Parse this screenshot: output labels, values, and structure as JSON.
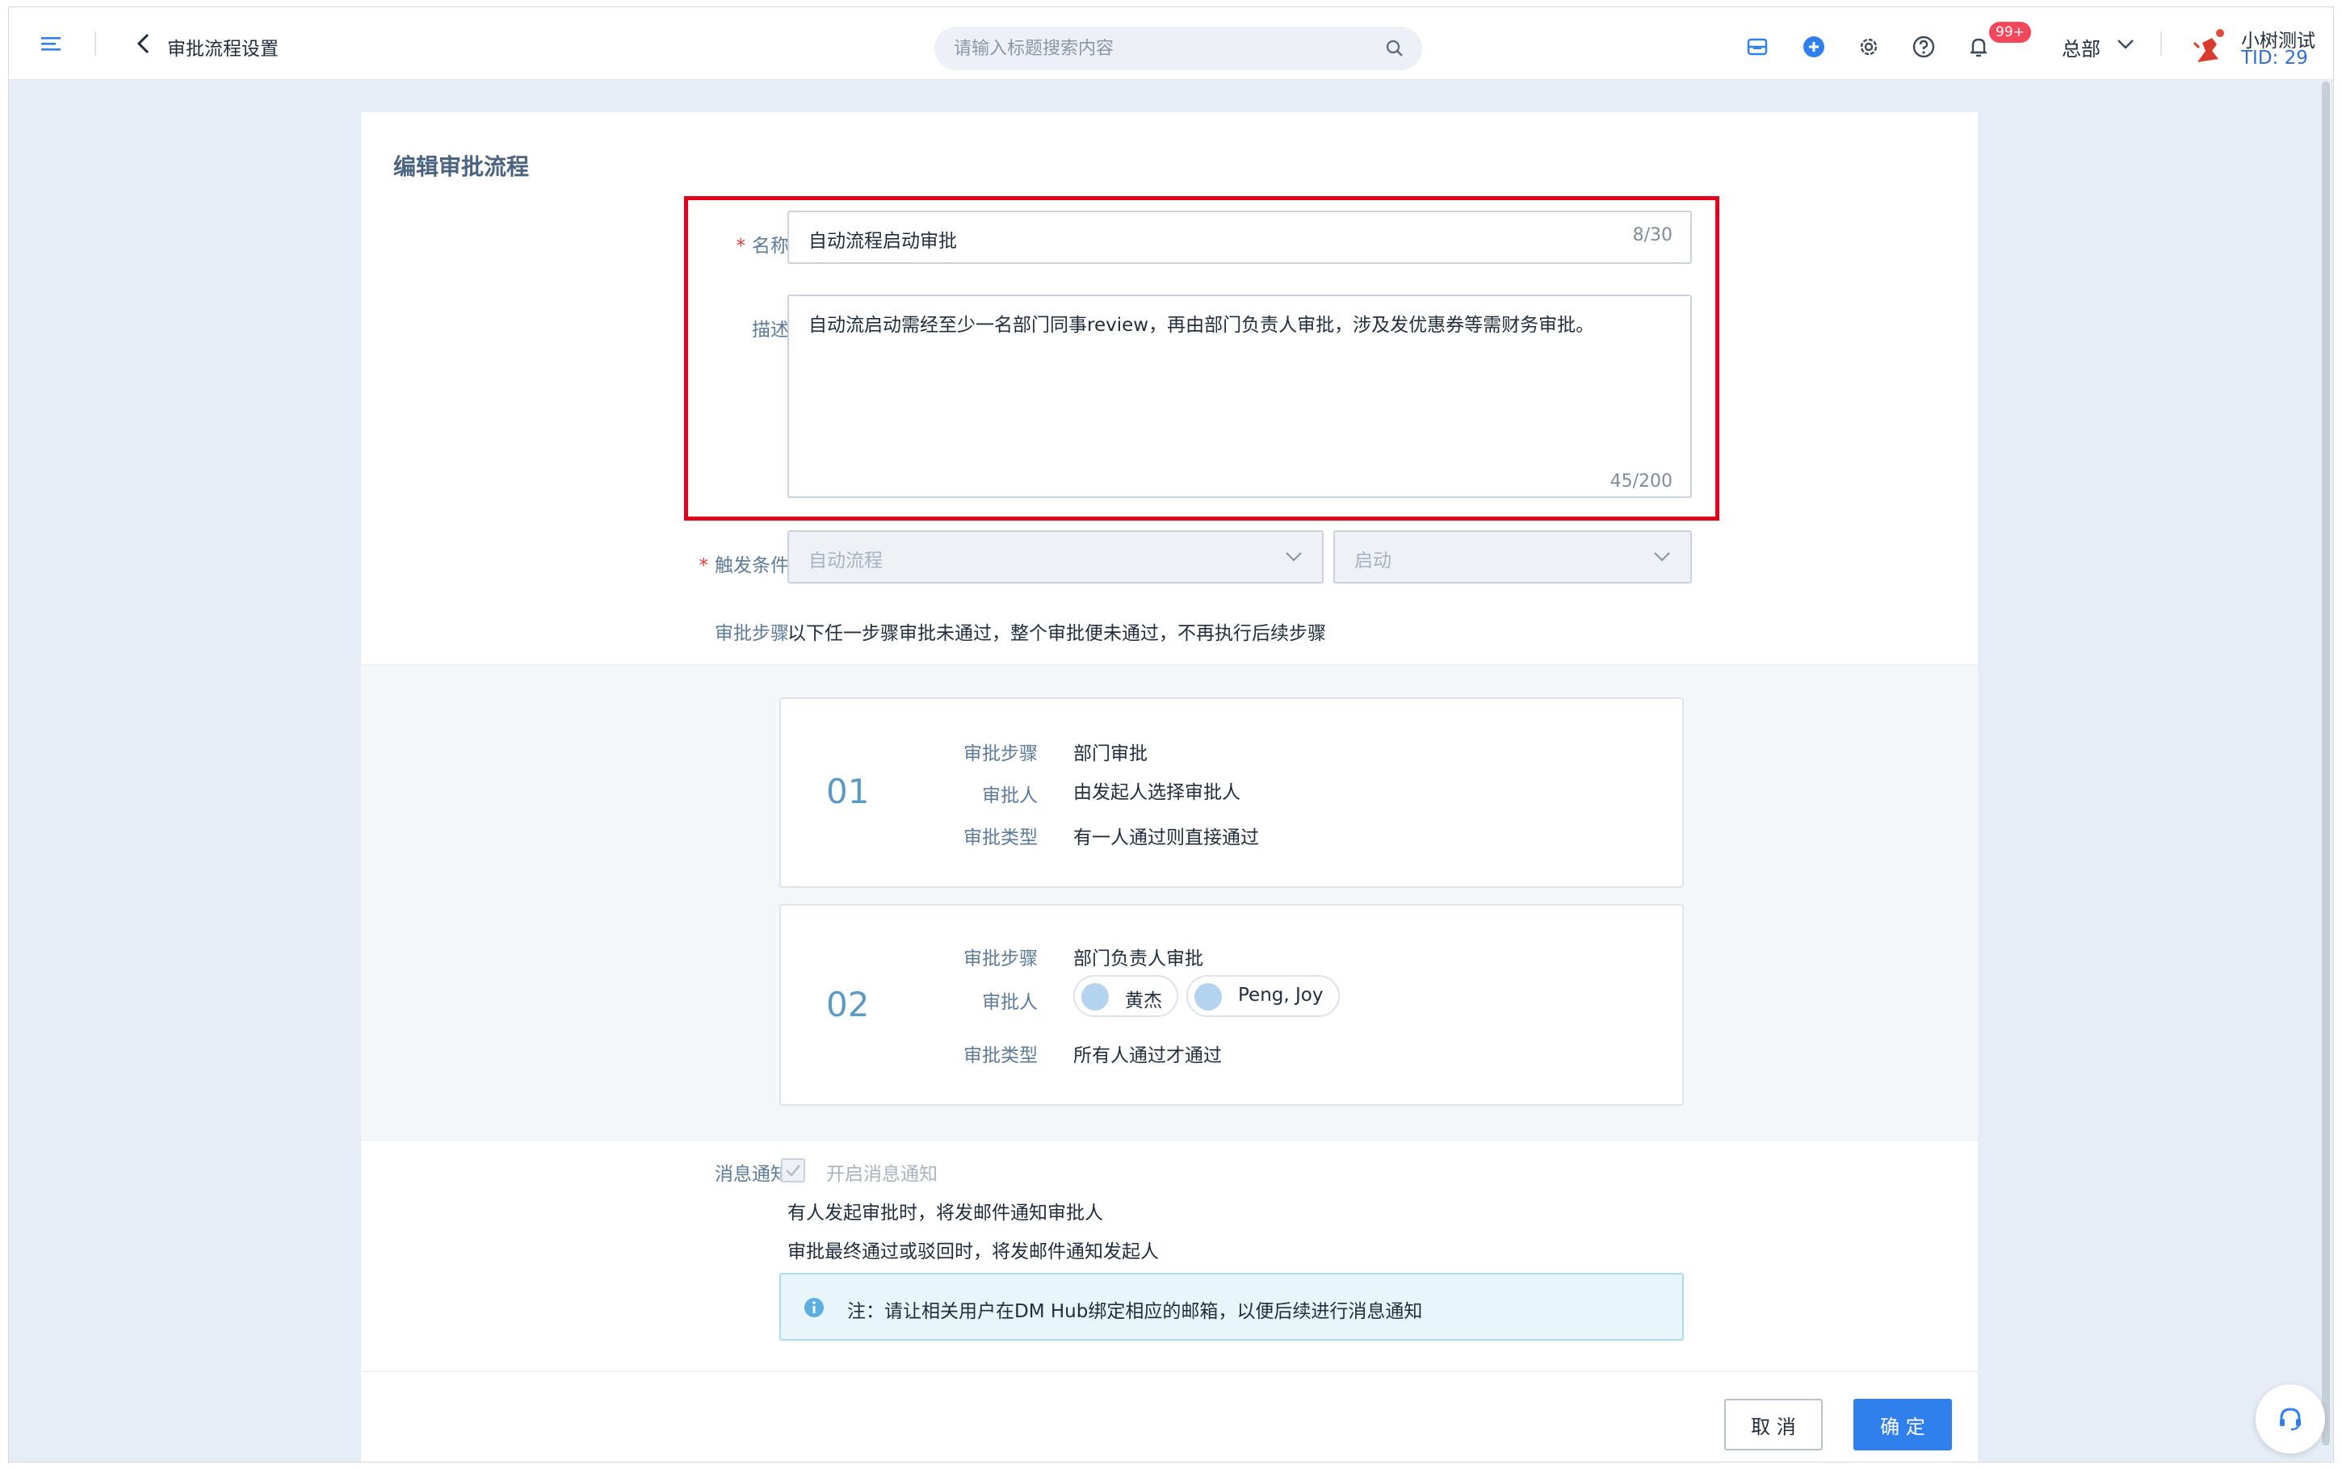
{
  "header": {
    "page_title": "审批流程设置",
    "search_placeholder": "请输入标题搜索内容",
    "notification_badge": "99+",
    "org": "总部",
    "user_name": "小树测试",
    "user_tid": "TID: 29"
  },
  "form": {
    "section_title": "编辑审批流程",
    "name_required": "*",
    "name_label": "名称",
    "name_value": "自动流程启动审批",
    "name_counter": "8/30",
    "desc_label": "描述",
    "desc_value": "自动流启动需经至少一名部门同事review，再由部门负责人审批，涉及发优惠券等需财务审批。",
    "desc_counter": "45/200",
    "trigger_required": "*",
    "trigger_label": "触发条件",
    "trigger_select1": "自动流程",
    "trigger_select2": "启动",
    "steps_label": "审批步骤",
    "steps_hint": "以下任一步骤审批未通过，整个审批便未通过，不再执行后续步骤"
  },
  "steps": [
    {
      "number": "01",
      "step_key": "审批步骤",
      "step_value": "部门审批",
      "approver_key": "审批人",
      "approver_value": "由发起人选择审批人",
      "type_key": "审批类型",
      "type_value": "有一人通过则直接通过"
    },
    {
      "number": "02",
      "step_key": "审批步骤",
      "step_value": "部门负责人审批",
      "approver_key": "审批人",
      "approvers": [
        "黄杰",
        "Peng, Joy"
      ],
      "type_key": "审批类型",
      "type_value": "所有人通过才通过"
    }
  ],
  "notification": {
    "label": "消息通知",
    "checkbox_label": "开启消息通知",
    "line1": "有人发起审批时，将发邮件通知审批人",
    "line2": "审批最终通过或驳回时，将发邮件通知发起人",
    "note": "注：请让相关用户在DM Hub绑定相应的邮箱，以便后续进行消息通知"
  },
  "actions": {
    "cancel": "取 消",
    "confirm": "确 定"
  },
  "colors": {
    "primary": "#2f80ed",
    "highlight": "#e3001b",
    "badge": "#f5475c"
  }
}
